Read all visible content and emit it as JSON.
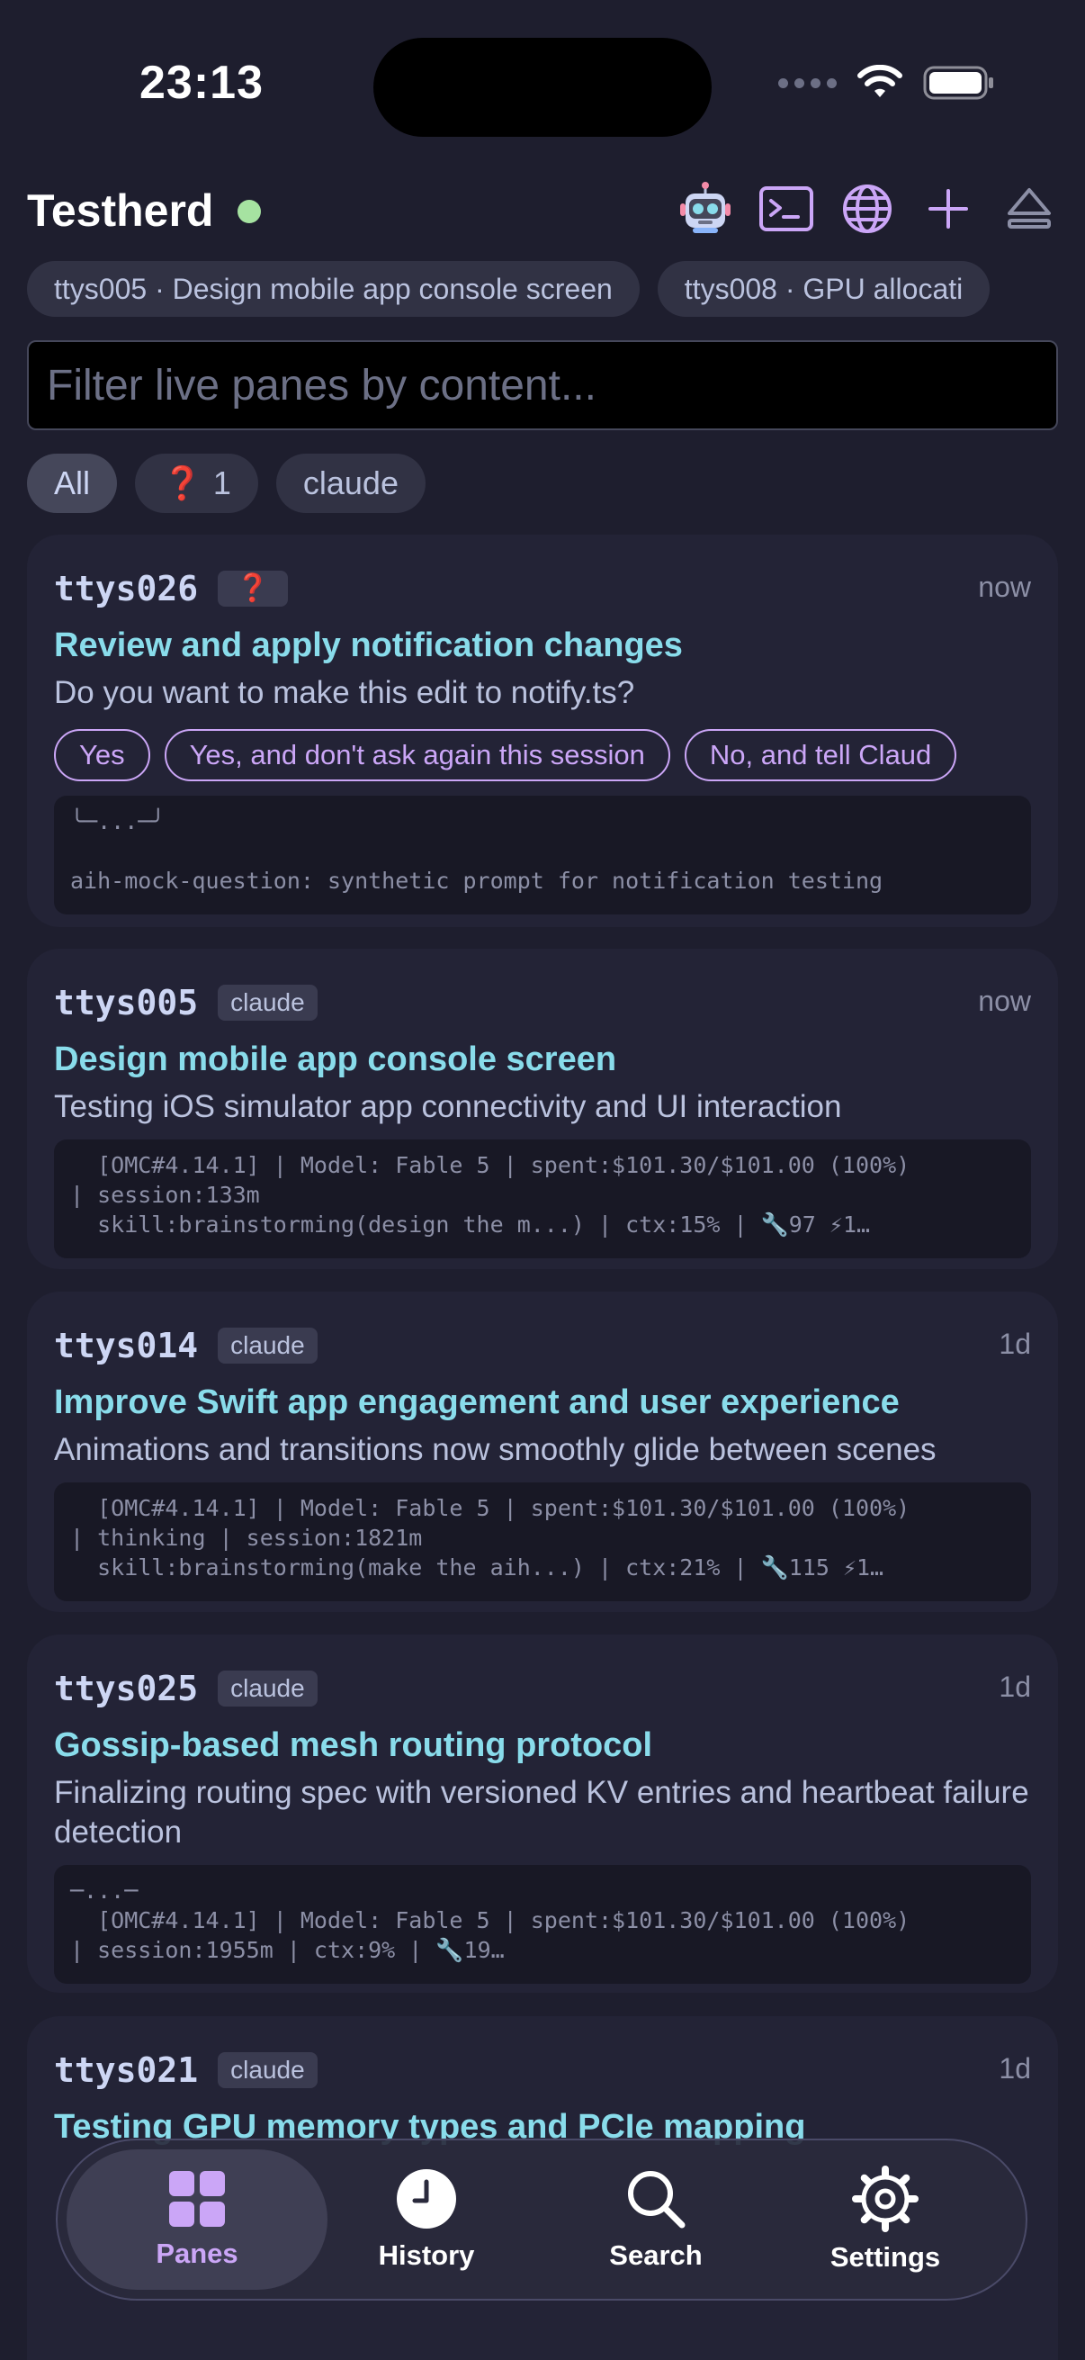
{
  "status_bar": {
    "time": "23:13"
  },
  "app": {
    "title": "Testherd"
  },
  "header_icons": [
    "robot-icon",
    "terminal-icon",
    "globe-icon",
    "plus-icon",
    "eject-icon"
  ],
  "session_chips": [
    "ttys005 · Design mobile app console screen",
    "ttys008 · GPU allocati"
  ],
  "filter": {
    "placeholder": "Filter live panes by content..."
  },
  "filter_tabs": {
    "all": "All",
    "question_count": "1",
    "claude": "claude"
  },
  "cards": [
    {
      "tty": "ttys026",
      "tag": "❓",
      "time": "now",
      "title": "Review and apply notification changes",
      "subtitle": "Do you want to make this edit to notify.ts?",
      "answers": [
        "Yes",
        "Yes, and don't ask again this session",
        "No, and tell Claud"
      ],
      "terminal": "╰─...─╯\n\naih-mock-question: synthetic prompt for notification testing"
    },
    {
      "tty": "ttys005",
      "tag": "claude",
      "time": "now",
      "title": "Design mobile app console screen",
      "subtitle": "Testing iOS simulator app connectivity and UI interaction",
      "terminal": "  [OMC#4.14.1] | Model: Fable 5 | spent:$101.30/$101.00 (100%)\n| session:133m\n  skill:brainstorming(design the m...) | ctx:15% | 🔧97 ⚡1…"
    },
    {
      "tty": "ttys014",
      "tag": "claude",
      "time": "1d",
      "title": "Improve Swift app engagement and user experience",
      "subtitle": "Animations and transitions now smoothly glide between scenes",
      "terminal": "  [OMC#4.14.1] | Model: Fable 5 | spent:$101.30/$101.00 (100%)\n| thinking | session:1821m\n  skill:brainstorming(make the aih...) | ctx:21% | 🔧115 ⚡1…"
    },
    {
      "tty": "ttys025",
      "tag": "claude",
      "time": "1d",
      "title": "Gossip-based mesh routing protocol",
      "subtitle": "Finalizing routing spec with versioned KV entries and heartbeat failure detection",
      "terminal": "─...─\n  [OMC#4.14.1] | Model: Fable 5 | spent:$101.30/$101.00 (100%)\n| session:1955m | ctx:9% | 🔧19…"
    },
    {
      "tty": "ttys021",
      "tag": "claude",
      "time": "1d",
      "title": "Testing GPU memory types and PCIe mapping",
      "subtitle": ""
    }
  ],
  "tabbar": {
    "panes": "Panes",
    "history": "History",
    "search": "Search",
    "settings": "Settings"
  },
  "colors": {
    "background": "#1e1e2e",
    "card": "#232336",
    "accent_title": "#89dceb",
    "accent_purple": "#cba6f7",
    "live_dot": "#a6e3a1",
    "question_red": "#e01b24"
  }
}
